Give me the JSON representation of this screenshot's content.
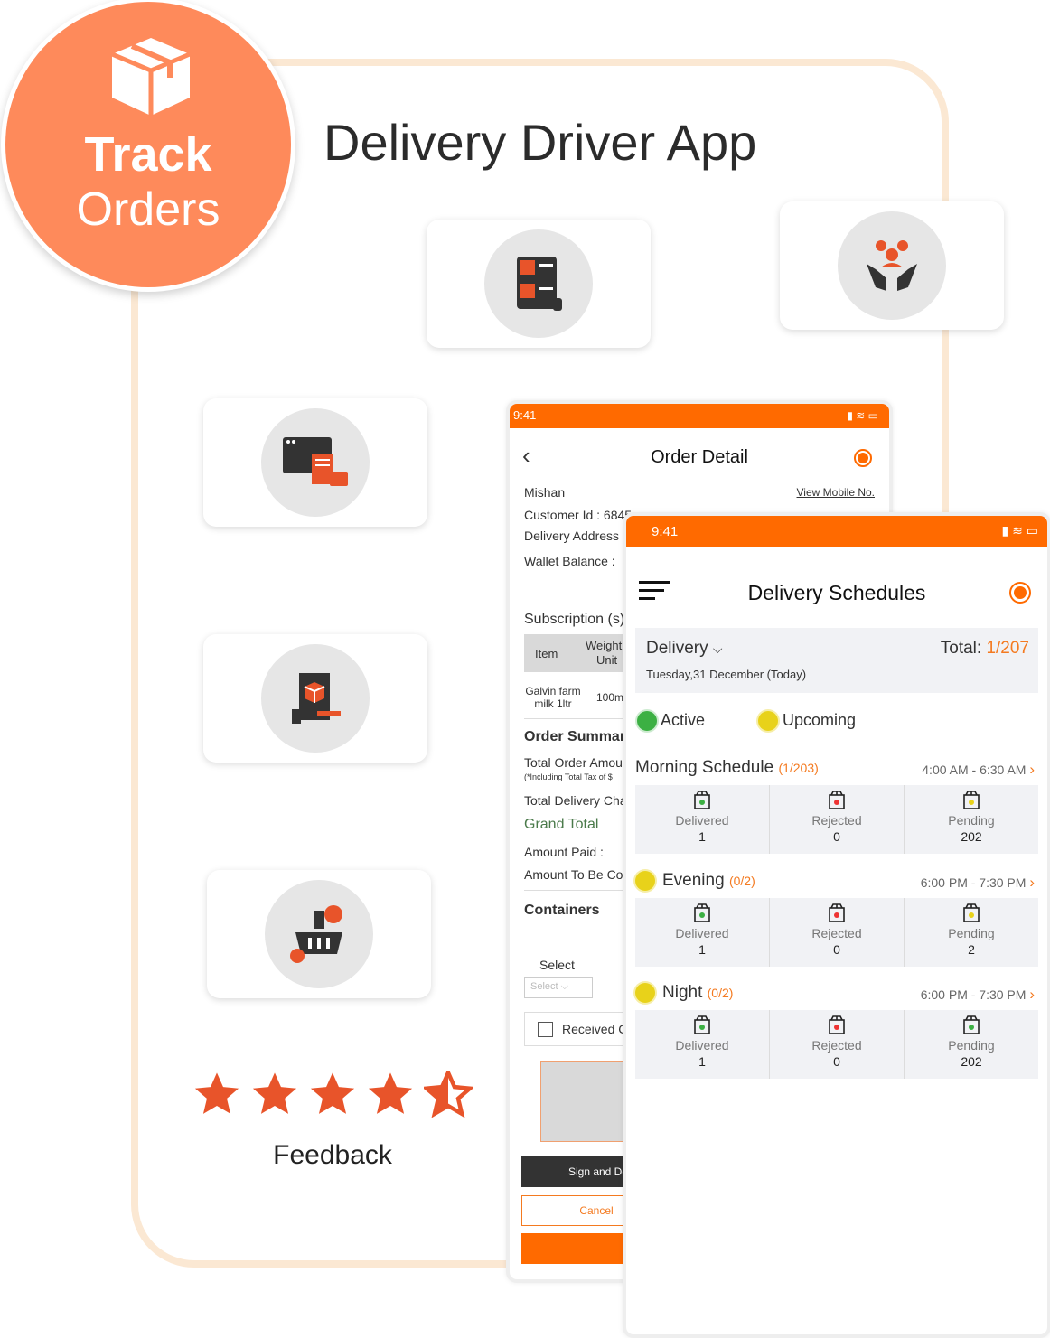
{
  "badge": {
    "line1": "Track",
    "line2": "Orders"
  },
  "title": "Delivery Driver App",
  "feature_icons": [
    "order-list-icon",
    "support-hands-icon",
    "web-invoice-icon",
    "product-catalog-icon",
    "grocery-basket-icon"
  ],
  "rating": {
    "stars": 4.5,
    "label": "Feedback"
  },
  "colors": {
    "accent": "#ff6a00",
    "badge": "#fe8a5b",
    "frame": "#fbe8d3",
    "grand_total": "#4a7a4a"
  },
  "order_detail": {
    "time": "9:41",
    "title": "Order Detail",
    "customer": "Mishan",
    "view_mobile": "View Mobile No.",
    "customer_id": "Customer Id :  6845",
    "delivery_address": "Delivery Address",
    "wallet_balance": "Wallet Balance :",
    "subscription": "Subscription (s)",
    "col_item": "Item",
    "col_weight": "Weight",
    "col_unit": "Unit",
    "row_item": "Galvin farm milk 1ltr",
    "row_weight": "100m",
    "order_summary": "Order Summary",
    "total_order": "Total Order Amou",
    "tax_note": "(*Including Total Tax of $",
    "total_delivery": "Total Delivery Cha",
    "grand_total": "Grand Total",
    "amount_paid": "Amount Paid :",
    "amount_collect": "Amount To Be Col",
    "containers": "Containers",
    "select_label": "Select",
    "select_placeholder": "Select",
    "received": "Received C",
    "sign_button": "Sign and De",
    "cancel_button": "Cancel"
  },
  "schedules": {
    "time": "9:41",
    "title": "Delivery Schedules",
    "filter": "Delivery",
    "date": "Tuesday,31 December (Today)",
    "total_label": "Total:",
    "total_value": "1/207",
    "legend": [
      {
        "label": "Active",
        "color": "#3cb043"
      },
      {
        "label": "Upcoming",
        "color": "#e8d21a"
      }
    ],
    "groups": [
      {
        "name": "Morning Schedule",
        "count": "(1/203)",
        "time": "4:00 AM - 6:30 AM",
        "stats": [
          {
            "label": "Delivered",
            "value": "1"
          },
          {
            "label": "Rejected",
            "value": "0"
          },
          {
            "label": "Pending",
            "value": "202"
          }
        ]
      },
      {
        "name": "Evening",
        "count": "(0/2)",
        "time": "6:00 PM - 7:30 PM",
        "stats": [
          {
            "label": "Delivered",
            "value": "1"
          },
          {
            "label": "Rejected",
            "value": "0"
          },
          {
            "label": "Pending",
            "value": "2"
          }
        ]
      },
      {
        "name": "Night",
        "count": "(0/2)",
        "time": "6:00 PM - 7:30 PM",
        "stats": [
          {
            "label": "Delivered",
            "value": "1"
          },
          {
            "label": "Rejected",
            "value": "0"
          },
          {
            "label": "Pending",
            "value": "202"
          }
        ]
      }
    ]
  }
}
